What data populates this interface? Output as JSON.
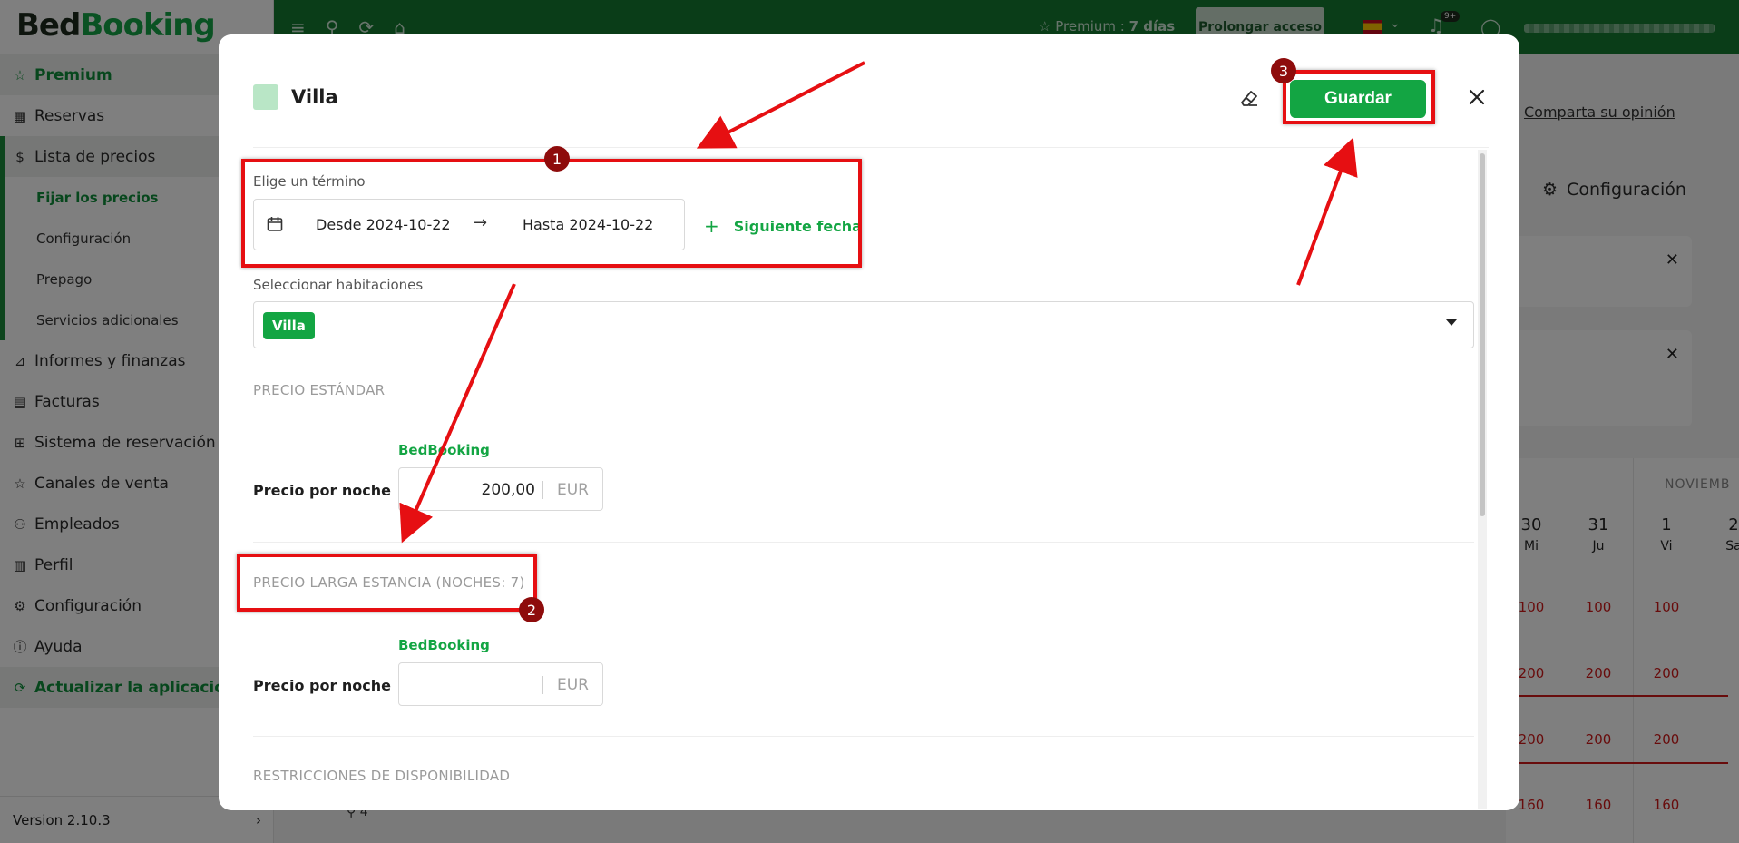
{
  "app": {
    "brand_part1": "Bed",
    "brand_part2": "Booking",
    "version": "Version 2.10.3"
  },
  "sidebar": {
    "items": [
      {
        "label": "Premium",
        "icon": "star-icon"
      },
      {
        "label": "Reservas",
        "icon": "calendar-icon"
      },
      {
        "label": "Lista de precios",
        "icon": "dollar-icon"
      },
      {
        "label": "Fijar los precios"
      },
      {
        "label": "Configuración"
      },
      {
        "label": "Prepago"
      },
      {
        "label": "Servicios adicionales"
      },
      {
        "label": "Informes y finanzas",
        "icon": "chart-icon"
      },
      {
        "label": "Facturas",
        "icon": "invoice-icon"
      },
      {
        "label": "Sistema de reservación",
        "icon": "grid-icon"
      },
      {
        "label": "Canales de venta",
        "icon": "star-outline-icon"
      },
      {
        "label": "Empleados",
        "icon": "person-add-icon"
      },
      {
        "label": "Perfil",
        "icon": "building-icon"
      },
      {
        "label": "Configuración",
        "icon": "gear-icon"
      },
      {
        "label": "Ayuda",
        "icon": "info-icon"
      },
      {
        "label": "Actualizar la aplicación",
        "icon": "refresh-icon"
      }
    ]
  },
  "topbar": {
    "premium_label": "Premium : ",
    "premium_days": "7 días",
    "prolong_label": "Prolongar acceso",
    "notif_badge": "9+"
  },
  "background": {
    "share_link": "Comparta su opinión",
    "config_label": "Configuración",
    "month": "NOVIEMB",
    "days": [
      {
        "num": "30",
        "wd": "Mi"
      },
      {
        "num": "31",
        "wd": "Ju"
      },
      {
        "num": "1",
        "wd": "Vi"
      },
      {
        "num": "2",
        "wd": "Sa"
      }
    ],
    "prices_row1": [
      "100",
      "100",
      "100"
    ],
    "prices_row2": [
      "200",
      "200",
      "200"
    ],
    "prices_row3": [
      "200",
      "200",
      "200"
    ],
    "prices_row4": [
      "160",
      "160",
      "160"
    ],
    "bottom_row": "4"
  },
  "modal": {
    "title": "Villa",
    "save_label": "Guardar",
    "term_label": "Elige un término",
    "from_label": "Desde 2024-10-22",
    "to_label": "Hasta 2024-10-22",
    "next_date_label": "Siguiente fecha",
    "rooms_label": "Seleccionar habitaciones",
    "room_tag": "Villa",
    "standard_section": "PRECIO ESTÁNDAR",
    "long_stay_section": "PRECIO LARGA ESTANCIA (NOCHES: 7)",
    "availability_section": "RESTRICCIONES DE DISPONIBILIDAD",
    "channel_label": "BedBooking",
    "price_per_night_label": "Precio por noche",
    "standard_price_value": "200,00",
    "long_stay_price_value": "",
    "currency": "EUR"
  },
  "annotations": {
    "badge1": "1",
    "badge2": "2",
    "badge3": "3",
    "color": "#e60f12"
  },
  "colors": {
    "accent": "#13a543",
    "topbar": "#147a31"
  }
}
